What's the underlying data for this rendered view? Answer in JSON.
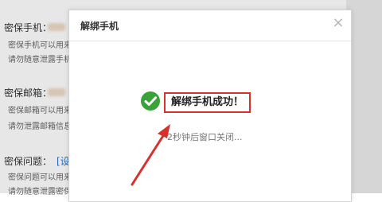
{
  "background": {
    "sections": [
      {
        "label": "密保手机：",
        "hints": [
          "密保手机可以用来",
          "请勿随意泄露手机"
        ]
      },
      {
        "label": "密保邮箱：",
        "hints": [
          "密保邮箱可以用来",
          "请勿泄露邮箱信息"
        ]
      },
      {
        "label": "密保问题：",
        "hints": [
          "密保问题可以用来",
          "请勿随意泄露密保"
        ],
        "link": "[设"
      }
    ]
  },
  "dialog": {
    "title": "解绑手机",
    "close_glyph": "×",
    "success_message": "解绑手机成功！",
    "sub_message": "2秒钟后窗口关闭..."
  },
  "colors": {
    "highlight": "#d8302b",
    "success": "#39a339",
    "link": "#2a6fc9"
  },
  "icons": {
    "check": "check-circle-icon",
    "close": "close-icon",
    "arrow": "annotation-arrow"
  }
}
